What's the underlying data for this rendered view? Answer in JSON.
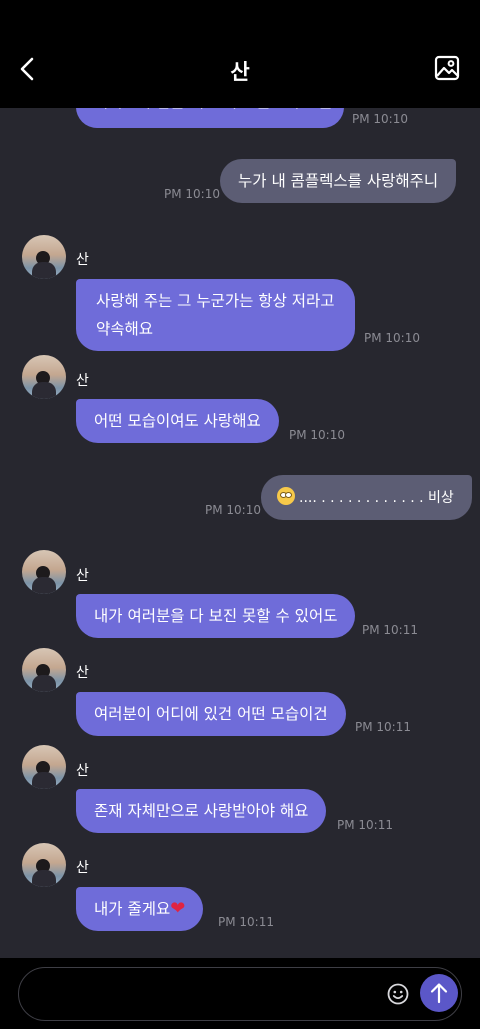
{
  "header": {
    "title": "산"
  },
  "chat": {
    "partial_message": "여러분이 힘들 때 그리고 불안해도 늘",
    "partial_time": "PM 10:10",
    "messages": [
      {
        "type": "sent",
        "text": "누가 내 콤플렉스를 사랑해주니",
        "time": "PM 10:10"
      },
      {
        "type": "recv",
        "sender": "산",
        "line1": "사랑해 주는 그 누군가는 항상 저라고",
        "line2": "약속해요",
        "time": "PM 10:10"
      },
      {
        "type": "recv",
        "sender": "산",
        "text": "어떤 모습이여도 사랑해요",
        "time": "PM 10:10"
      },
      {
        "type": "sent",
        "text": ".... . . . . . . . . . . . . 비상",
        "time": "PM 10:10",
        "emoji": "face-with-rolling-eyes"
      },
      {
        "type": "recv",
        "sender": "산",
        "text": "내가 여러분을 다 보진 못할 수 있어도",
        "time": "PM 10:11"
      },
      {
        "type": "recv",
        "sender": "산",
        "text": "여러분이 어디에 있건 어떤 모습이건",
        "time": "PM 10:11"
      },
      {
        "type": "recv",
        "sender": "산",
        "text": "존재 자체만으로 사랑받아야 해요",
        "time": "PM 10:11"
      },
      {
        "type": "recv",
        "sender": "산",
        "text": "내가 줄게요",
        "time": "PM 10:11",
        "emoji": "red-heart"
      }
    ]
  },
  "input": {
    "value": "",
    "placeholder": ""
  },
  "colors": {
    "received_bubble": "#6f6cd9",
    "sent_bubble": "#5c5d74",
    "background": "#27272f",
    "send_button": "#5b57c8"
  }
}
